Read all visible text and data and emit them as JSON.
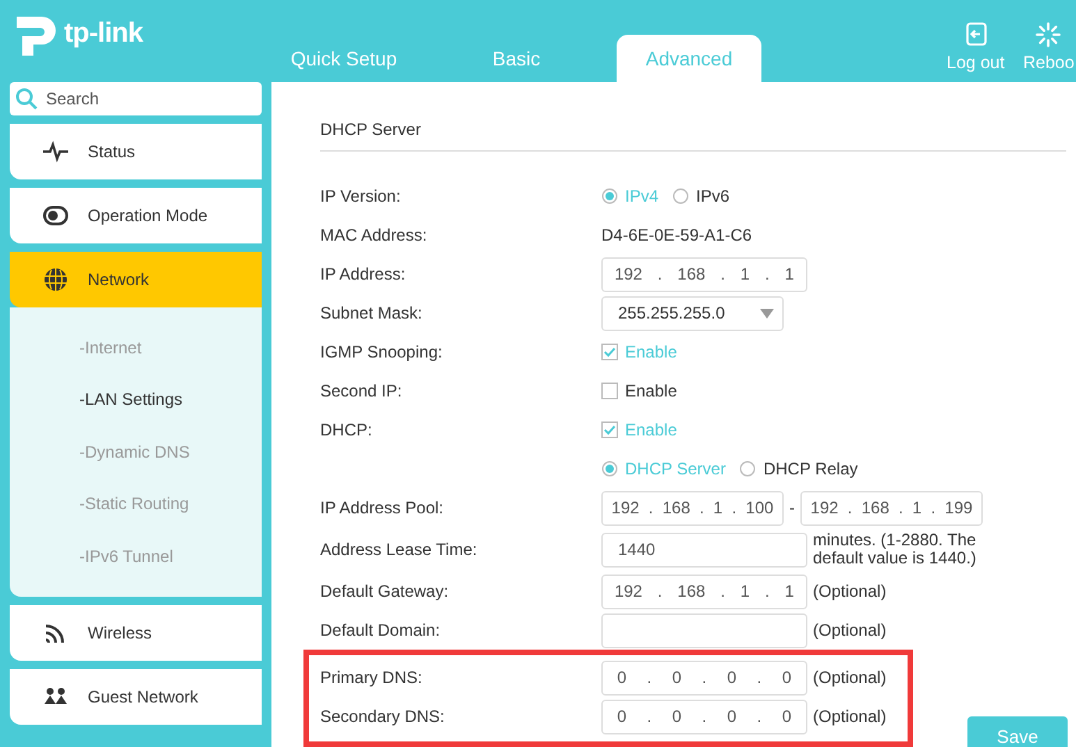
{
  "header": {
    "logo": "tp-link",
    "tabs": [
      {
        "label": "Quick Setup",
        "selected": false
      },
      {
        "label": "Basic",
        "selected": false
      },
      {
        "label": "Advanced",
        "selected": true
      }
    ],
    "actions": [
      {
        "kind": "logout",
        "label": "Log out"
      },
      {
        "kind": "reboot",
        "label": "Reboo"
      }
    ]
  },
  "sidebar": {
    "search": {
      "placeholder": "Search"
    },
    "items": [
      {
        "kind": "status",
        "label": "Status",
        "selected": false
      },
      {
        "kind": "mode",
        "label": "Operation Mode",
        "selected": false
      },
      {
        "kind": "network",
        "label": "Network",
        "selected": true,
        "expanded": true,
        "children": [
          {
            "label": "-Internet",
            "selected": false
          },
          {
            "label": "-LAN Settings",
            "selected": true
          },
          {
            "label": "-Dynamic DNS",
            "selected": false
          },
          {
            "label": "-Static Routing",
            "selected": false
          },
          {
            "label": "-IPv6 Tunnel",
            "selected": false
          }
        ]
      },
      {
        "kind": "wireless",
        "label": "Wireless",
        "selected": false
      },
      {
        "kind": "guest",
        "label": "Guest Network",
        "selected": false
      }
    ]
  },
  "section": {
    "title": "DHCP Server",
    "separator": ".",
    "rows": [
      {
        "kind": "radio",
        "label": "IP Version:",
        "options": [
          {
            "label": "IPv4",
            "selected": true
          },
          {
            "label": "IPv6",
            "selected": false
          }
        ]
      },
      {
        "kind": "text",
        "label": "MAC Address:",
        "value": "D4-6E-0E-59-A1-C6"
      },
      {
        "kind": "ip",
        "label": "IP Address:",
        "octets": [
          "192",
          "168",
          "1",
          "1"
        ]
      },
      {
        "kind": "select",
        "label": "Subnet Mask:",
        "value": "255.255.255.0"
      },
      {
        "kind": "checkbox",
        "label": "IGMP Snooping:",
        "option": "Enable",
        "checked": true
      },
      {
        "kind": "checkbox",
        "label": "Second IP:",
        "option": "Enable",
        "checked": false
      },
      {
        "kind": "checkbox",
        "label": "DHCP:",
        "option": "Enable",
        "checked": true
      },
      {
        "kind": "radio",
        "options": [
          {
            "label": "DHCP Server",
            "selected": true
          },
          {
            "label": "DHCP Relay",
            "selected": false
          }
        ]
      },
      {
        "kind": "range",
        "label": "IP Address Pool:",
        "from": [
          "192",
          "168",
          "1",
          "100"
        ],
        "dash": "-",
        "to": [
          "192",
          "168",
          "1",
          "199"
        ]
      },
      {
        "kind": "input",
        "label": "Address Lease Time:",
        "value": "1440",
        "note": "minutes. (1-2880. The default value is 1440.)"
      },
      {
        "kind": "ip",
        "label": "Default Gateway:",
        "octets": [
          "192",
          "168",
          "1",
          "1"
        ],
        "note": "(Optional)"
      },
      {
        "kind": "input",
        "label": "Default Domain:",
        "value": "",
        "note": "(Optional)"
      },
      {
        "kind": "ip",
        "label": "Primary DNS:",
        "octets": [
          "0",
          "0",
          "0",
          "0"
        ],
        "note": "(Optional)",
        "highlighted": true
      },
      {
        "kind": "ip",
        "label": "Secondary DNS:",
        "octets": [
          "0",
          "0",
          "0",
          "0"
        ],
        "note": "(Optional)",
        "highlighted": true
      }
    ],
    "save": "Save"
  }
}
